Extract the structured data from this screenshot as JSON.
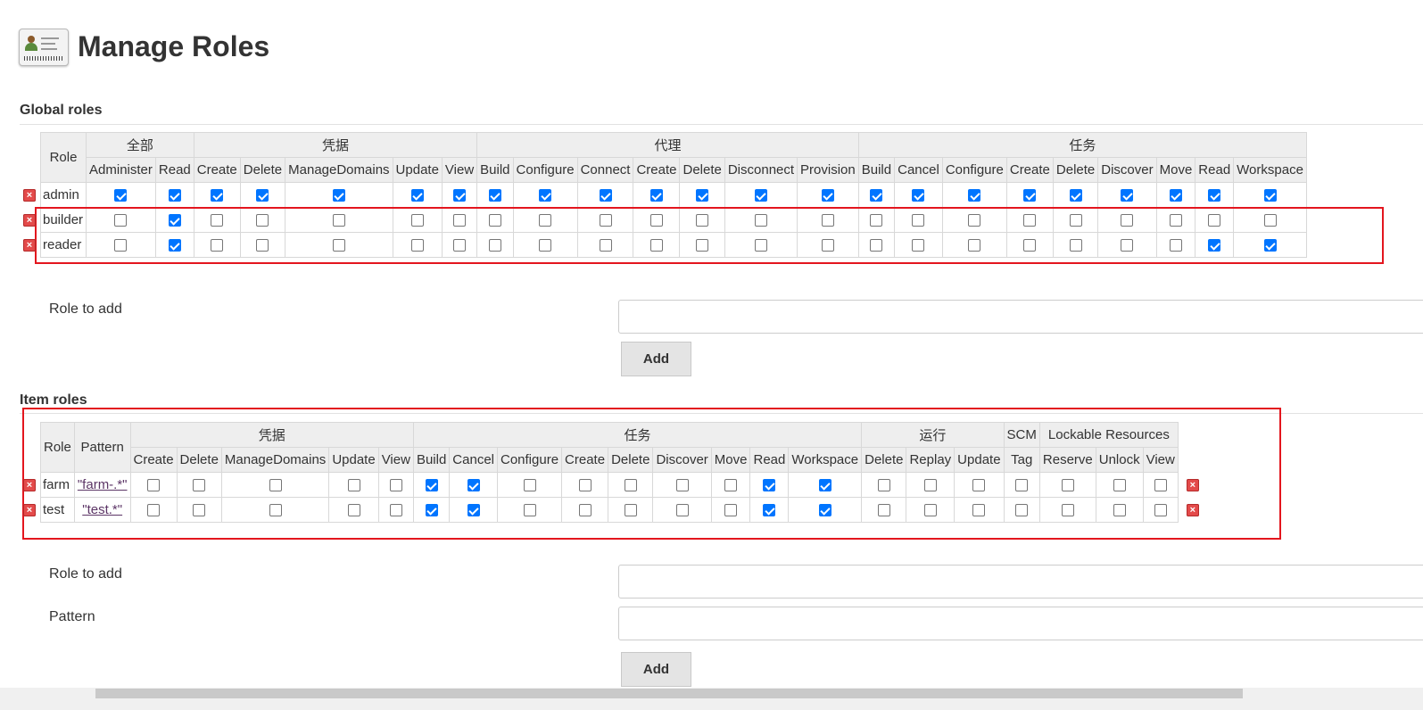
{
  "page": {
    "title": "Manage Roles"
  },
  "global": {
    "title": "Global roles",
    "role_header": "Role",
    "groups": [
      {
        "label": "全部",
        "perms": [
          "Administer",
          "Read"
        ]
      },
      {
        "label": "凭据",
        "perms": [
          "Create",
          "Delete",
          "ManageDomains",
          "Update",
          "View"
        ]
      },
      {
        "label": "代理",
        "perms": [
          "Build",
          "Configure",
          "Connect",
          "Create",
          "Delete",
          "Disconnect",
          "Provision"
        ]
      },
      {
        "label": "任务",
        "perms": [
          "Build",
          "Cancel",
          "Configure",
          "Create",
          "Delete",
          "Discover",
          "Move",
          "Read",
          "Workspace"
        ]
      }
    ],
    "roles": [
      {
        "name": "admin",
        "checks": [
          1,
          1,
          1,
          1,
          1,
          1,
          1,
          1,
          1,
          1,
          1,
          1,
          1,
          1,
          1,
          1,
          1,
          1,
          1,
          1,
          1,
          1,
          1
        ]
      },
      {
        "name": "builder",
        "checks": [
          0,
          1,
          0,
          0,
          0,
          0,
          0,
          0,
          0,
          0,
          0,
          0,
          0,
          0,
          0,
          0,
          0,
          0,
          0,
          0,
          0,
          0,
          0
        ]
      },
      {
        "name": "reader",
        "checks": [
          0,
          1,
          0,
          0,
          0,
          0,
          0,
          0,
          0,
          0,
          0,
          0,
          0,
          0,
          0,
          0,
          0,
          0,
          0,
          0,
          0,
          1,
          1
        ]
      }
    ],
    "role_to_add_label": "Role to add",
    "add_label": "Add"
  },
  "item": {
    "title": "Item roles",
    "role_header": "Role",
    "pattern_header": "Pattern",
    "groups": [
      {
        "label": "凭据",
        "perms": [
          "Create",
          "Delete",
          "ManageDomains",
          "Update",
          "View"
        ]
      },
      {
        "label": "任务",
        "perms": [
          "Build",
          "Cancel",
          "Configure",
          "Create",
          "Delete",
          "Discover",
          "Move",
          "Read",
          "Workspace"
        ]
      },
      {
        "label": "运行",
        "perms": [
          "Delete",
          "Replay",
          "Update"
        ]
      },
      {
        "label": "SCM",
        "perms": [
          "Tag"
        ]
      },
      {
        "label": "Lockable Resources",
        "perms": [
          "Reserve",
          "Unlock",
          "View"
        ]
      }
    ],
    "roles": [
      {
        "name": "farm",
        "pattern": "\"farm-.*\"",
        "checks": [
          0,
          0,
          0,
          0,
          0,
          1,
          1,
          0,
          0,
          0,
          0,
          0,
          1,
          1,
          0,
          0,
          0,
          0,
          0,
          0,
          0
        ]
      },
      {
        "name": "test",
        "pattern": "\"test.*\"",
        "checks": [
          0,
          0,
          0,
          0,
          0,
          1,
          1,
          0,
          0,
          0,
          0,
          0,
          1,
          1,
          0,
          0,
          0,
          0,
          0,
          0,
          0
        ]
      }
    ],
    "role_to_add_label": "Role to add",
    "pattern_label": "Pattern",
    "add_label": "Add"
  },
  "colors": {
    "highlight": "#e3161e",
    "checkbox_checked": "#0075ff",
    "delete_icon": "#e34a4a"
  }
}
